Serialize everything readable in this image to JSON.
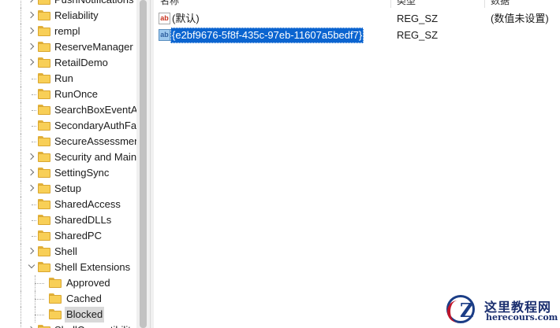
{
  "tree": {
    "items": [
      {
        "label": "PushNotifications",
        "expander": "collapsed",
        "selected": false
      },
      {
        "label": "Reliability",
        "expander": "collapsed",
        "selected": false
      },
      {
        "label": "rempl",
        "expander": "collapsed",
        "selected": false
      },
      {
        "label": "ReserveManager",
        "expander": "collapsed",
        "selected": false
      },
      {
        "label": "RetailDemo",
        "expander": "collapsed",
        "selected": false
      },
      {
        "label": "Run",
        "expander": "none",
        "selected": false
      },
      {
        "label": "RunOnce",
        "expander": "none",
        "selected": false
      },
      {
        "label": "SearchBoxEventArgs",
        "expander": "none",
        "selected": false
      },
      {
        "label": "SecondaryAuthFactor",
        "expander": "none",
        "selected": false
      },
      {
        "label": "SecureAssessment",
        "expander": "none",
        "selected": false
      },
      {
        "label": "Security and Maintenance",
        "expander": "collapsed",
        "selected": false
      },
      {
        "label": "SettingSync",
        "expander": "collapsed",
        "selected": false
      },
      {
        "label": "Setup",
        "expander": "collapsed",
        "selected": false
      },
      {
        "label": "SharedAccess",
        "expander": "none",
        "selected": false
      },
      {
        "label": "SharedDLLs",
        "expander": "none",
        "selected": false
      },
      {
        "label": "SharedPC",
        "expander": "none",
        "selected": false
      },
      {
        "label": "Shell",
        "expander": "collapsed",
        "selected": false
      },
      {
        "label": "Shell Extensions",
        "expander": "expanded",
        "selected": false
      },
      {
        "label": "Approved",
        "expander": "none",
        "selected": false,
        "child": true
      },
      {
        "label": "Cached",
        "expander": "none",
        "selected": false,
        "child": true
      },
      {
        "label": "Blocked",
        "expander": "none",
        "selected": true,
        "child": true
      },
      {
        "label": "ShellCompatibility",
        "expander": "collapsed",
        "selected": false
      }
    ]
  },
  "list": {
    "columns": {
      "name": "名称",
      "type": "类型",
      "data": "数据"
    },
    "rows": [
      {
        "icon": "string-value-icon",
        "name": "(默认)",
        "type": "REG_SZ",
        "data": "(数值未设置)",
        "selected": false
      },
      {
        "icon": "string-value-icon",
        "name": "{e2bf9676-5f8f-435c-97eb-11607a5bedf7}",
        "type": "REG_SZ",
        "data": "",
        "selected": true
      }
    ]
  },
  "watermark": {
    "site_name": "这里教程网",
    "url": "herecours.com",
    "logo_letter": "Z"
  },
  "colors": {
    "selection": "#0a64d0",
    "folder": "#f8cf57",
    "watermark_blue": "#1b3d86",
    "watermark_red": "#c0152a"
  }
}
